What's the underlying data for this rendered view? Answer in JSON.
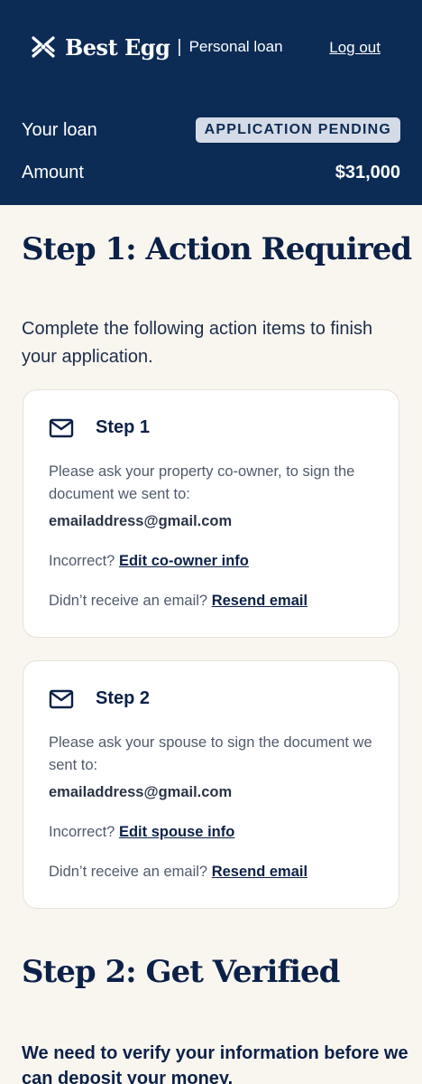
{
  "header": {
    "brand": "Best Egg",
    "separator": "|",
    "product": "Personal loan",
    "logout_label": "Log out",
    "loan_label": "Your loan",
    "status_badge": "APPLICATION PENDING",
    "amount_label": "Amount",
    "amount_value": "$31,000"
  },
  "section1": {
    "title": "Step 1: Action Required",
    "intro": "Complete the following action items to finish your application.",
    "cards": [
      {
        "title": "Step 1",
        "icon": "mail-icon",
        "body": "Please ask your property co-owner, to sign the document we sent to:",
        "email": "emailaddress@gmail.com",
        "incorrect_label": "Incorrect?",
        "edit_link": "Edit co-owner info",
        "resend_prompt": "Didn’t receive an email?",
        "resend_link": "Resend email"
      },
      {
        "title": "Step 2",
        "icon": "mail-icon",
        "body": "Please ask your spouse to sign the document we sent to:",
        "email": "emailaddress@gmail.com",
        "incorrect_label": "Incorrect?",
        "edit_link": "Edit spouse info",
        "resend_prompt": "Didn’t receive an email?",
        "resend_link": "Resend email"
      }
    ]
  },
  "section2": {
    "title": "Step 2: Get Verified",
    "intro": "We need to verify your information before we can deposit your money."
  },
  "colors": {
    "header_bg": "#0c2b55",
    "page_bg": "#f9f6f0",
    "badge_bg": "#d4dbe6"
  }
}
